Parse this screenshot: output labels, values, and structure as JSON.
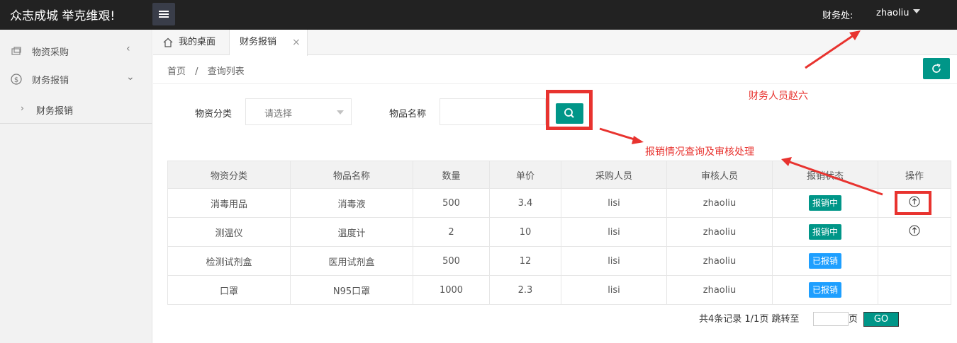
{
  "header": {
    "brand": "众志成城 举克维艰!",
    "user_role_label": "财务处:",
    "user_name": "zhaoliu"
  },
  "sidebar": {
    "items": [
      {
        "label": "物资采购",
        "icon": "purchase-icon",
        "chevron": "‹"
      },
      {
        "label": "财务报销",
        "icon": "dollar-icon",
        "chevron": "⌄"
      }
    ],
    "sub_items": [
      {
        "label": "财务报销"
      }
    ]
  },
  "tabs": [
    {
      "label": "我的桌面"
    },
    {
      "label": "财务报销",
      "close": "×"
    }
  ],
  "breadcrumb": [
    "首页",
    "/",
    "查询列表"
  ],
  "filters": {
    "category_label": "物资分类",
    "category_placeholder": "请选择",
    "name_label": "物品名称",
    "name_value": ""
  },
  "table": {
    "headers": [
      "物资分类",
      "物品名称",
      "数量",
      "单价",
      "采购人员",
      "审核人员",
      "报销状态",
      "操作"
    ],
    "rows": [
      {
        "category": "消毒用品",
        "name": "消毒液",
        "qty": "500",
        "price": "3.4",
        "buyer": "lisi",
        "auditor": "zhaoliu",
        "status": "报销中",
        "status_color": "#009688",
        "action": true
      },
      {
        "category": "测温仪",
        "name": "温度计",
        "qty": "2",
        "price": "10",
        "buyer": "lisi",
        "auditor": "zhaoliu",
        "status": "报销中",
        "status_color": "#009688",
        "action": true
      },
      {
        "category": "检测试剂盒",
        "name": "医用试剂盒",
        "qty": "500",
        "price": "12",
        "buyer": "lisi",
        "auditor": "zhaoliu",
        "status": "已报销",
        "status_color": "#1e9fff",
        "action": false
      },
      {
        "category": "口罩",
        "name": "N95口罩",
        "qty": "1000",
        "price": "2.3",
        "buyer": "lisi",
        "auditor": "zhaoliu",
        "status": "已报销",
        "status_color": "#1e9fff",
        "action": false
      }
    ]
  },
  "pager": {
    "summary": "共4条记录  1/1页  跳转至",
    "page_suffix": "页",
    "go_label": "GO"
  },
  "annotations": {
    "finance_person": "财务人员赵六",
    "query_note": "报销情况查询及审核处理"
  },
  "colors": {
    "accent": "#009688",
    "annotation": "#e8332f",
    "done": "#1e9fff"
  }
}
